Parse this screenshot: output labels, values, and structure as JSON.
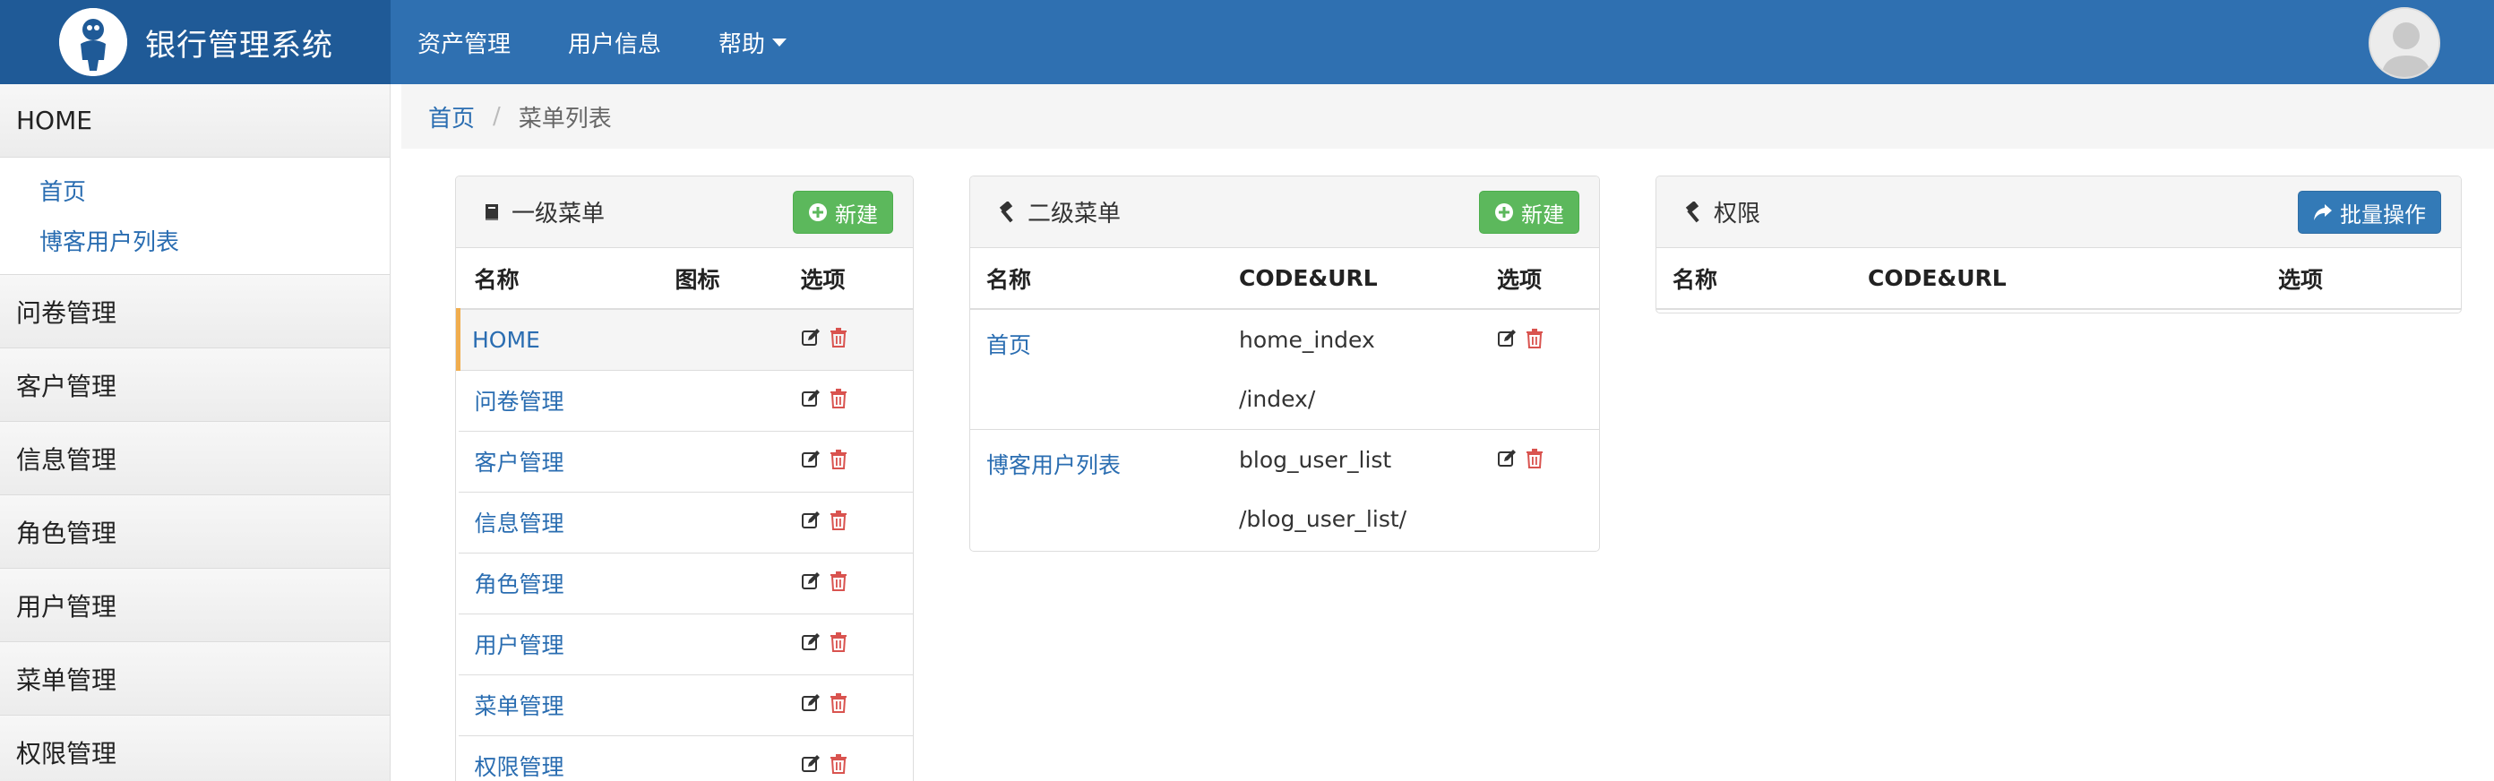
{
  "navbar": {
    "brand_title": "银行管理系统",
    "links": [
      {
        "label": "资产管理"
      },
      {
        "label": "用户信息"
      },
      {
        "label": "帮助",
        "has_caret": true
      }
    ]
  },
  "sidebar": {
    "home_label": "HOME",
    "home_items": [
      {
        "label": "首页"
      },
      {
        "label": "博客用户列表"
      }
    ],
    "groups": [
      {
        "label": "问卷管理"
      },
      {
        "label": "客户管理"
      },
      {
        "label": "信息管理"
      },
      {
        "label": "角色管理"
      },
      {
        "label": "用户管理"
      },
      {
        "label": "菜单管理"
      },
      {
        "label": "权限管理"
      }
    ]
  },
  "breadcrumb": {
    "home": "首页",
    "separator": "/",
    "current": "菜单列表"
  },
  "panel_menu1": {
    "title": "一级菜单",
    "button_label": "新建",
    "columns": [
      "名称",
      "图标",
      "选项"
    ],
    "rows": [
      {
        "name": "HOME",
        "icon": "",
        "active": true
      },
      {
        "name": "问卷管理",
        "icon": ""
      },
      {
        "name": "客户管理",
        "icon": ""
      },
      {
        "name": "信息管理",
        "icon": ""
      },
      {
        "name": "角色管理",
        "icon": ""
      },
      {
        "name": "用户管理",
        "icon": ""
      },
      {
        "name": "菜单管理",
        "icon": ""
      },
      {
        "name": "权限管理",
        "icon": ""
      }
    ]
  },
  "panel_menu2": {
    "title": "二级菜单",
    "button_label": "新建",
    "columns": [
      "名称",
      "CODE&URL",
      "选项"
    ],
    "rows": [
      {
        "name": "首页",
        "code": "home_index",
        "url": "/index/"
      },
      {
        "name": "博客用户列表",
        "code": "blog_user_list",
        "url": "/blog_user_list/"
      }
    ]
  },
  "panel_perm": {
    "title": "权限",
    "button_label": "批量操作",
    "columns": [
      "名称",
      "CODE&URL",
      "选项"
    ]
  },
  "colors": {
    "navbar": "#2f70b1",
    "brand_bg": "#1f5a97",
    "link": "#2a6db1",
    "success": "#5cb85c",
    "primary": "#337ab7",
    "delete_icon": "#d9534f",
    "active_marker": "#f0ad4e"
  },
  "icons": {
    "brand_logo": "person-logo-icon",
    "avatar": "user-avatar-icon",
    "menu1": "book-icon",
    "menu2": "gavel-icon",
    "perm": "gavel-icon",
    "new": "plus-circle-icon",
    "batch": "share-icon",
    "edit": "edit-icon",
    "delete": "trash-icon"
  }
}
